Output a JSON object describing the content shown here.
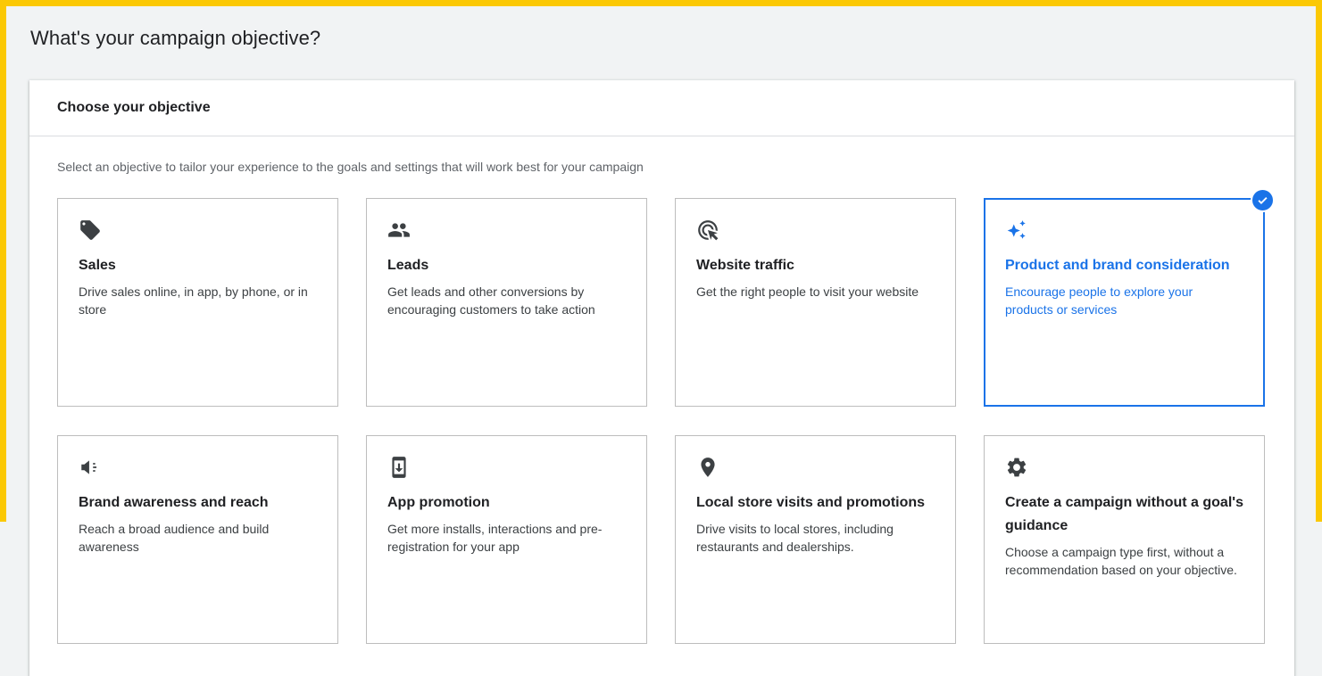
{
  "page": {
    "title": "What's your campaign objective?"
  },
  "objective_card": {
    "header": "Choose your objective",
    "description": "Select an objective to tailor your experience to the goals and settings that will work best for your campaign"
  },
  "objectives": [
    {
      "icon": "tag-icon",
      "title": "Sales",
      "description": "Drive sales online, in app, by phone, or in store",
      "selected": false
    },
    {
      "icon": "people-icon",
      "title": "Leads",
      "description": "Get leads and other conversions by encouraging customers to take action",
      "selected": false
    },
    {
      "icon": "cursor-click-icon",
      "title": "Website traffic",
      "description": "Get the right people to visit your website",
      "selected": false
    },
    {
      "icon": "sparkle-icon",
      "title": "Product and brand consideration",
      "description": "Encourage people to explore your products or services",
      "selected": true
    },
    {
      "icon": "megaphone-icon",
      "title": "Brand awareness and reach",
      "description": "Reach a broad audience and build awareness",
      "selected": false
    },
    {
      "icon": "phone-download-icon",
      "title": "App promotion",
      "description": "Get more installs, interactions and pre-registration for your app",
      "selected": false
    },
    {
      "icon": "location-pin-icon",
      "title": "Local store visits and promotions",
      "description": "Drive visits to local stores, including restaurants and dealerships.",
      "selected": false
    },
    {
      "icon": "gear-icon",
      "title": "Create a campaign without a goal's guidance",
      "description": "Choose a campaign type first, without a recommendation based on your objective.",
      "selected": false
    }
  ],
  "colors": {
    "frame": "#fbc804",
    "accent": "#1a73e8",
    "page_background": "#f1f3f4"
  }
}
